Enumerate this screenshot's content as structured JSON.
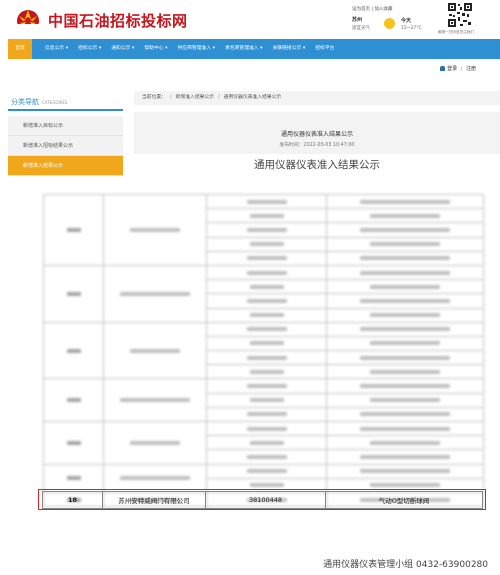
{
  "header": {
    "site_title": "中国石油招标投标网",
    "links": "设为首页 | 加入收藏",
    "city": "苏州",
    "weather_label": "适宜天气",
    "today_label": "今天",
    "temperature": "15~27°C",
    "qr_caption": "截屏一扫码查关注我们"
  },
  "nav": {
    "items": [
      "首页",
      "信息公示 ▾",
      "招标公示 ▾",
      "通知公示 ▾",
      "帮助中心 ▾",
      "供应商管理准入 ▾",
      "承包商管理准入 ▾",
      "关联链接公示 ▾",
      "招标平台"
    ]
  },
  "login": {
    "login_label": "登录",
    "separator": "|",
    "register_label": "注册"
  },
  "sidebar": {
    "title": "分类导航",
    "subtitle": "CATEGORIES",
    "items": [
      "新增准入目标公示",
      "新增准入招标结果公示",
      "新增准入结果公示"
    ]
  },
  "breadcrumb": {
    "prefix": "当前位置：",
    "items": [
      "新增准入结果公示",
      "通用仪器仪表准入结果公示"
    ]
  },
  "article": {
    "title": "通用仪器仪表准入结果公示",
    "time": "发布时间：2022-03-03 10:47:00",
    "big_title": "通用仪器仪表准入结果公示"
  },
  "table": {
    "highlight_row": {
      "no": "18",
      "company": "苏州安特威阀门有限公司",
      "code": "38100448",
      "product": "气动O型切断球阀"
    }
  },
  "footer": {
    "text": "通用仪器仪表管理小组 0432-63900280"
  },
  "colors": {
    "brand_red": "#c8141c",
    "nav_blue": "#2e8fd3",
    "active_orange": "#f0a71c",
    "highlight_red": "#e02020"
  }
}
